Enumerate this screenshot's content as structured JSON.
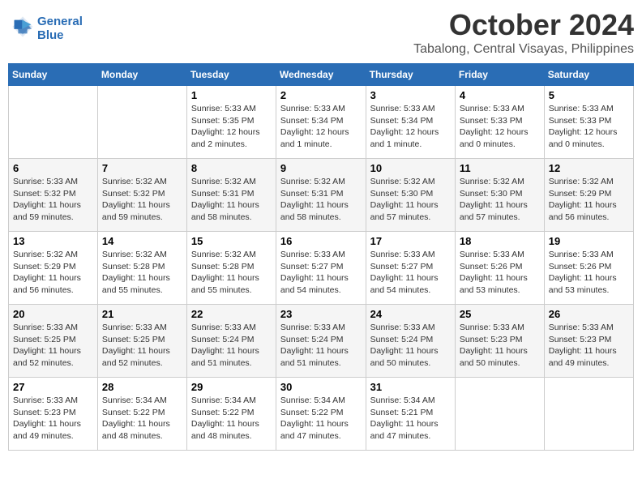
{
  "header": {
    "logo_line1": "General",
    "logo_line2": "Blue",
    "month": "October 2024",
    "location": "Tabalong, Central Visayas, Philippines"
  },
  "weekdays": [
    "Sunday",
    "Monday",
    "Tuesday",
    "Wednesday",
    "Thursday",
    "Friday",
    "Saturday"
  ],
  "weeks": [
    [
      {
        "day": "",
        "info": ""
      },
      {
        "day": "",
        "info": ""
      },
      {
        "day": "1",
        "info": "Sunrise: 5:33 AM\nSunset: 5:35 PM\nDaylight: 12 hours\nand 2 minutes."
      },
      {
        "day": "2",
        "info": "Sunrise: 5:33 AM\nSunset: 5:34 PM\nDaylight: 12 hours\nand 1 minute."
      },
      {
        "day": "3",
        "info": "Sunrise: 5:33 AM\nSunset: 5:34 PM\nDaylight: 12 hours\nand 1 minute."
      },
      {
        "day": "4",
        "info": "Sunrise: 5:33 AM\nSunset: 5:33 PM\nDaylight: 12 hours\nand 0 minutes."
      },
      {
        "day": "5",
        "info": "Sunrise: 5:33 AM\nSunset: 5:33 PM\nDaylight: 12 hours\nand 0 minutes."
      }
    ],
    [
      {
        "day": "6",
        "info": "Sunrise: 5:33 AM\nSunset: 5:32 PM\nDaylight: 11 hours\nand 59 minutes."
      },
      {
        "day": "7",
        "info": "Sunrise: 5:32 AM\nSunset: 5:32 PM\nDaylight: 11 hours\nand 59 minutes."
      },
      {
        "day": "8",
        "info": "Sunrise: 5:32 AM\nSunset: 5:31 PM\nDaylight: 11 hours\nand 58 minutes."
      },
      {
        "day": "9",
        "info": "Sunrise: 5:32 AM\nSunset: 5:31 PM\nDaylight: 11 hours\nand 58 minutes."
      },
      {
        "day": "10",
        "info": "Sunrise: 5:32 AM\nSunset: 5:30 PM\nDaylight: 11 hours\nand 57 minutes."
      },
      {
        "day": "11",
        "info": "Sunrise: 5:32 AM\nSunset: 5:30 PM\nDaylight: 11 hours\nand 57 minutes."
      },
      {
        "day": "12",
        "info": "Sunrise: 5:32 AM\nSunset: 5:29 PM\nDaylight: 11 hours\nand 56 minutes."
      }
    ],
    [
      {
        "day": "13",
        "info": "Sunrise: 5:32 AM\nSunset: 5:29 PM\nDaylight: 11 hours\nand 56 minutes."
      },
      {
        "day": "14",
        "info": "Sunrise: 5:32 AM\nSunset: 5:28 PM\nDaylight: 11 hours\nand 55 minutes."
      },
      {
        "day": "15",
        "info": "Sunrise: 5:32 AM\nSunset: 5:28 PM\nDaylight: 11 hours\nand 55 minutes."
      },
      {
        "day": "16",
        "info": "Sunrise: 5:33 AM\nSunset: 5:27 PM\nDaylight: 11 hours\nand 54 minutes."
      },
      {
        "day": "17",
        "info": "Sunrise: 5:33 AM\nSunset: 5:27 PM\nDaylight: 11 hours\nand 54 minutes."
      },
      {
        "day": "18",
        "info": "Sunrise: 5:33 AM\nSunset: 5:26 PM\nDaylight: 11 hours\nand 53 minutes."
      },
      {
        "day": "19",
        "info": "Sunrise: 5:33 AM\nSunset: 5:26 PM\nDaylight: 11 hours\nand 53 minutes."
      }
    ],
    [
      {
        "day": "20",
        "info": "Sunrise: 5:33 AM\nSunset: 5:25 PM\nDaylight: 11 hours\nand 52 minutes."
      },
      {
        "day": "21",
        "info": "Sunrise: 5:33 AM\nSunset: 5:25 PM\nDaylight: 11 hours\nand 52 minutes."
      },
      {
        "day": "22",
        "info": "Sunrise: 5:33 AM\nSunset: 5:24 PM\nDaylight: 11 hours\nand 51 minutes."
      },
      {
        "day": "23",
        "info": "Sunrise: 5:33 AM\nSunset: 5:24 PM\nDaylight: 11 hours\nand 51 minutes."
      },
      {
        "day": "24",
        "info": "Sunrise: 5:33 AM\nSunset: 5:24 PM\nDaylight: 11 hours\nand 50 minutes."
      },
      {
        "day": "25",
        "info": "Sunrise: 5:33 AM\nSunset: 5:23 PM\nDaylight: 11 hours\nand 50 minutes."
      },
      {
        "day": "26",
        "info": "Sunrise: 5:33 AM\nSunset: 5:23 PM\nDaylight: 11 hours\nand 49 minutes."
      }
    ],
    [
      {
        "day": "27",
        "info": "Sunrise: 5:33 AM\nSunset: 5:23 PM\nDaylight: 11 hours\nand 49 minutes."
      },
      {
        "day": "28",
        "info": "Sunrise: 5:34 AM\nSunset: 5:22 PM\nDaylight: 11 hours\nand 48 minutes."
      },
      {
        "day": "29",
        "info": "Sunrise: 5:34 AM\nSunset: 5:22 PM\nDaylight: 11 hours\nand 48 minutes."
      },
      {
        "day": "30",
        "info": "Sunrise: 5:34 AM\nSunset: 5:22 PM\nDaylight: 11 hours\nand 47 minutes."
      },
      {
        "day": "31",
        "info": "Sunrise: 5:34 AM\nSunset: 5:21 PM\nDaylight: 11 hours\nand 47 minutes."
      },
      {
        "day": "",
        "info": ""
      },
      {
        "day": "",
        "info": ""
      }
    ]
  ]
}
